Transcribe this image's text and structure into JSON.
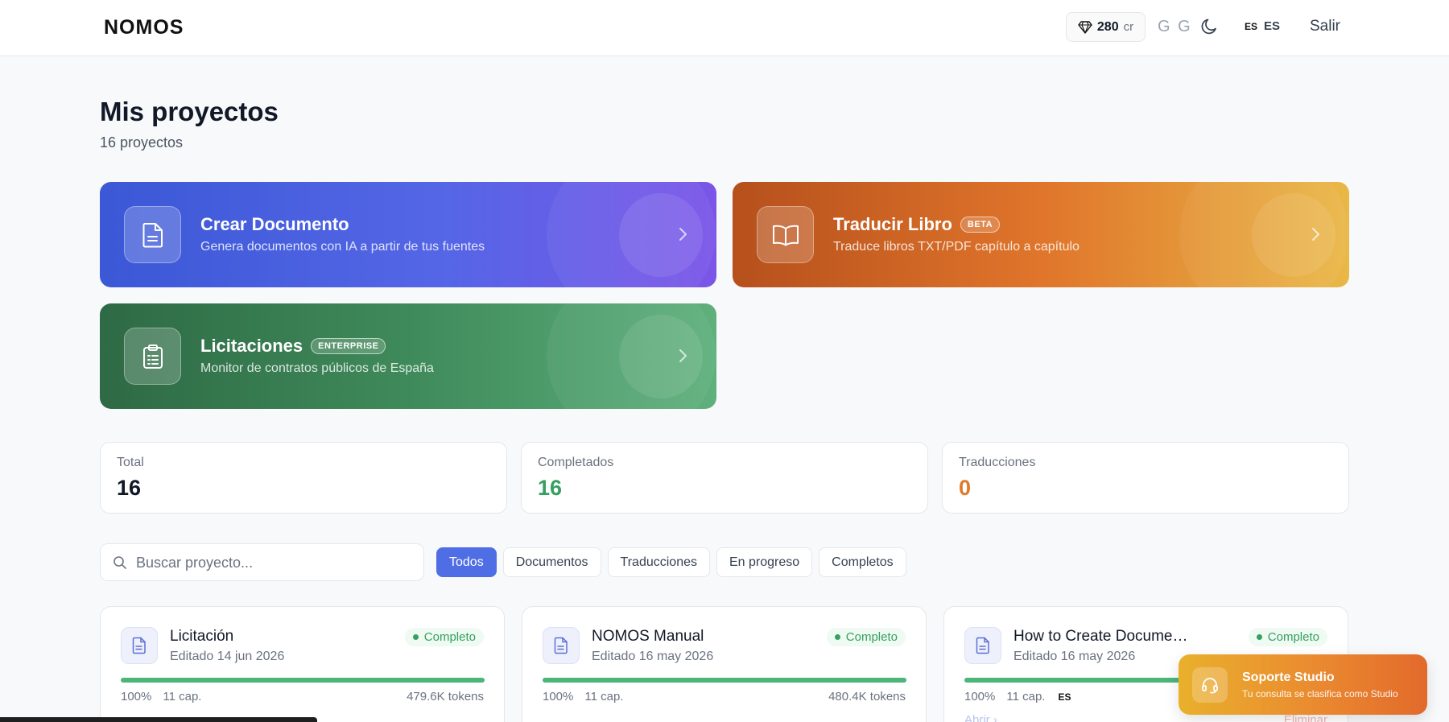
{
  "header": {
    "logo": "NOMOS",
    "credits_value": "280",
    "credits_unit": "cr",
    "user_initials": "G G",
    "lang_small": "ES",
    "lang_big": "ES",
    "logout_label": "Salir",
    "icons": {
      "credits": "gem-icon",
      "theme": "moon-icon"
    }
  },
  "page": {
    "title": "Mis proyectos",
    "subtitle": "16 proyectos"
  },
  "feature_cards": [
    {
      "title": "Crear Documento",
      "badge": "",
      "description": "Genera documentos con IA a partir de tus fuentes",
      "icon": "document-icon"
    },
    {
      "title": "Traducir Libro",
      "badge": "BETA",
      "description": "Traduce libros TXT/PDF capítulo a capítulo",
      "icon": "book-icon"
    },
    {
      "title": "Licitaciones",
      "badge": "ENTERPRISE",
      "description": "Monitor de contratos públicos de España",
      "icon": "clipboard-icon"
    }
  ],
  "stats": [
    {
      "label": "Total",
      "value": "16",
      "color": "#111827"
    },
    {
      "label": "Completados",
      "value": "16",
      "color": "#36a061"
    },
    {
      "label": "Traducciones",
      "value": "0",
      "color": "#e07a2b"
    }
  ],
  "search": {
    "placeholder": "Buscar proyecto..."
  },
  "filters": [
    {
      "label": "Todos",
      "active": true
    },
    {
      "label": "Documentos",
      "active": false
    },
    {
      "label": "Traducciones",
      "active": false
    },
    {
      "label": "En progreso",
      "active": false
    },
    {
      "label": "Completos",
      "active": false
    }
  ],
  "projects": [
    {
      "title": "Licitación",
      "edited": "Editado 14 jun 2026",
      "status": "Completo",
      "progress": 1.0,
      "progress_label": "100%",
      "chapters": "11 cap.",
      "tokens": "479.6K tokens",
      "lang": "",
      "open": "",
      "delete": ""
    },
    {
      "title": "NOMOS Manual",
      "edited": "Editado 16 may 2026",
      "status": "Completo",
      "progress": 1.0,
      "progress_label": "100%",
      "chapters": "11 cap.",
      "tokens": "480.4K tokens",
      "lang": "",
      "open": "",
      "delete": ""
    },
    {
      "title": "How to Create Documents with...",
      "edited": "Editado 16 may 2026",
      "status": "Completo",
      "progress": 1.0,
      "progress_label": "100%",
      "chapters": "11 cap.",
      "tokens": "",
      "lang": "ES",
      "open": "Abrir ›",
      "delete": "Eliminar"
    }
  ],
  "support": {
    "title": "Soporte Studio",
    "subtitle": "Tu consulta se clasifica como Studio",
    "icon": "headset-icon"
  },
  "colors": {
    "accent": "#4f6ee6",
    "success": "#36a061",
    "warning": "#e07a2b"
  }
}
